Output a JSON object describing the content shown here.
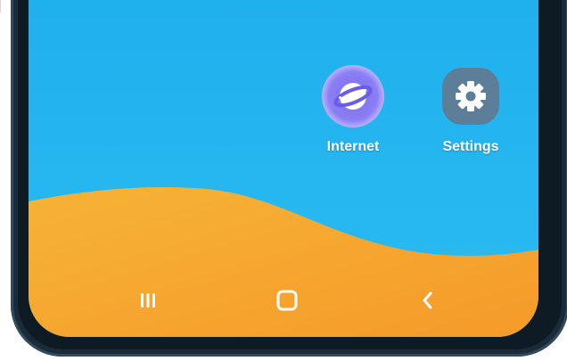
{
  "apps": [
    {
      "label": "Internet",
      "icon": "internet-planet-icon"
    },
    {
      "label": "Settings",
      "icon": "gear-icon"
    }
  ],
  "nav": {
    "recent_icon": "recent-apps-icon",
    "home_icon": "home-icon",
    "back_icon": "back-icon"
  },
  "colors": {
    "sky": "#26b6f0",
    "sand": "#f4a530",
    "frame": "#1a2b3a",
    "internet_bg": "#8c7ff2",
    "settings_bg": "#5d7e99"
  }
}
